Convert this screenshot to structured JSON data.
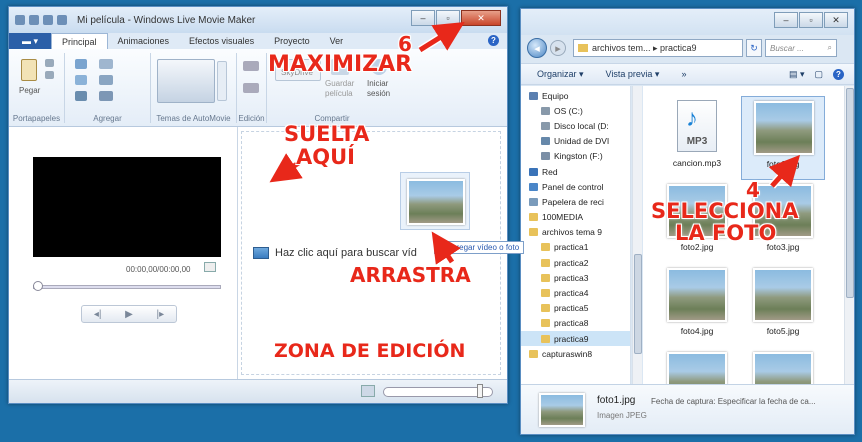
{
  "movie_maker": {
    "title": "Mi película - Windows Live Movie Maker",
    "tabs": [
      "Principal",
      "Animaciones",
      "Efectos visuales",
      "Proyecto",
      "Ver"
    ],
    "ribbon": {
      "paste_label": "Pegar",
      "groups": [
        "Portapapeles",
        "Agregar",
        "Temas de AutoMovie",
        "Edición",
        "Compartir"
      ],
      "skydrive": "SkyDrive",
      "save_movie": "Guardar película",
      "sign_in": "Iniciar sesión"
    },
    "timecode": "00:00,00/00:00,00",
    "browse_text": "Haz clic aquí para buscar víd",
    "add_tooltip": "Agregar vídeo o foto"
  },
  "annotations": {
    "maximize_num": "6",
    "maximize": "MAXIMIZAR",
    "drop_line1": "SUELTA",
    "drop_line2": "AQUÍ",
    "drag": "ARRASTRA",
    "edit_zone": "ZONA DE EDICIÓN",
    "select_num": "4",
    "select_line1": "SELECCIONA",
    "select_line2": "LA FOTO"
  },
  "explorer": {
    "address": "archivos tem... ▸ practica9",
    "search_placeholder": "Buscar ...",
    "commands": [
      "Organizar ▾",
      "Vista previa ▾",
      "»"
    ],
    "nav_items": [
      {
        "label": "Equipo",
        "indent": 0,
        "color": "#5a7fb0"
      },
      {
        "label": "OS (C:)",
        "indent": 1,
        "color": "#8899aa"
      },
      {
        "label": "Disco local (D:",
        "indent": 1,
        "color": "#8899aa"
      },
      {
        "label": "Unidad de DVI",
        "indent": 1,
        "color": "#6688aa"
      },
      {
        "label": "Kingston (F:)",
        "indent": 1,
        "color": "#7b8fa6"
      },
      {
        "label": "Red",
        "indent": 0,
        "color": "#3a73b8"
      },
      {
        "label": "Panel de control",
        "indent": 0,
        "color": "#4a86c8"
      },
      {
        "label": "Papelera de reci",
        "indent": 0,
        "color": "#7a9bbb"
      },
      {
        "label": "100MEDIA",
        "indent": 0,
        "color": "#e8c25a"
      },
      {
        "label": "archivos tema 9",
        "indent": 0,
        "color": "#e8c25a"
      },
      {
        "label": "practica1",
        "indent": 1,
        "color": "#e8c25a"
      },
      {
        "label": "practica2",
        "indent": 1,
        "color": "#e8c25a"
      },
      {
        "label": "practica3",
        "indent": 1,
        "color": "#e8c25a"
      },
      {
        "label": "practica4",
        "indent": 1,
        "color": "#e8c25a"
      },
      {
        "label": "practica5",
        "indent": 1,
        "color": "#e8c25a"
      },
      {
        "label": "practica8",
        "indent": 1,
        "color": "#e8c25a"
      },
      {
        "label": "practica9",
        "indent": 1,
        "color": "#e8c25a",
        "selected": true
      },
      {
        "label": "capturaswin8",
        "indent": 0,
        "color": "#e8c25a"
      }
    ],
    "files": [
      {
        "name": "cancion.mp3",
        "kind": "mp3"
      },
      {
        "name": "foto1.jpg",
        "kind": "photo",
        "selected": true
      },
      {
        "name": "foto2.jpg",
        "kind": "photo"
      },
      {
        "name": "foto3.jpg",
        "kind": "photo"
      },
      {
        "name": "foto4.jpg",
        "kind": "photo"
      },
      {
        "name": "foto5.jpg",
        "kind": "photo"
      },
      {
        "name": "",
        "kind": "photo"
      },
      {
        "name": "",
        "kind": "photo"
      }
    ],
    "details": {
      "name": "foto1.jpg",
      "type": "Imagen JPEG",
      "date": "Fecha de captura: Especificar la fecha de ca..."
    }
  }
}
